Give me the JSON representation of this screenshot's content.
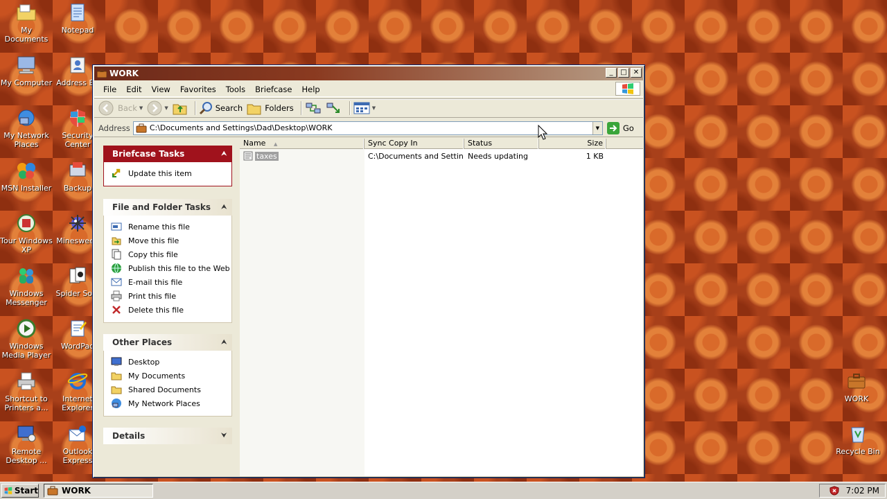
{
  "colors": {
    "briefcase_header": "#a0121c",
    "titlebar": "#6b2a1a",
    "desktop": "#a8401a"
  },
  "desktop_left": [
    {
      "label": "My Documents",
      "icon": "folder-documents-icon"
    },
    {
      "label": "My Computer",
      "icon": "computer-icon"
    },
    {
      "label": "My Network Places",
      "icon": "network-places-icon"
    },
    {
      "label": "MSN Installer",
      "icon": "msn-butterfly-icon"
    },
    {
      "label": "Tour Windows XP",
      "icon": "tour-icon"
    },
    {
      "label": "Windows Messenger",
      "icon": "messenger-icon"
    },
    {
      "label": "Windows Media Player",
      "icon": "media-player-icon"
    },
    {
      "label": "Shortcut to Printers a...",
      "icon": "printer-icon"
    },
    {
      "label": "Remote Desktop ...",
      "icon": "remote-desktop-icon"
    }
  ],
  "desktop_second": [
    {
      "label": "Notepad",
      "icon": "notepad-icon"
    },
    {
      "label": "Address Bo",
      "icon": "address-book-icon"
    },
    {
      "label": "Security Center",
      "icon": "security-shield-icon"
    },
    {
      "label": "Backup",
      "icon": "backup-icon"
    },
    {
      "label": "Minesweep",
      "icon": "minesweeper-icon"
    },
    {
      "label": "Spider Solit",
      "icon": "spider-solitaire-icon"
    },
    {
      "label": "WordPad",
      "icon": "wordpad-icon"
    },
    {
      "label": "Internet Explorer",
      "icon": "internet-explorer-icon"
    },
    {
      "label": "Outlook Express",
      "icon": "outlook-express-icon"
    }
  ],
  "desktop_right": [
    {
      "label": "WORK",
      "icon": "briefcase-icon"
    },
    {
      "label": "Recycle Bin",
      "icon": "recycle-bin-icon"
    }
  ],
  "window": {
    "title": "WORK",
    "menus": [
      "File",
      "Edit",
      "View",
      "Favorites",
      "Tools",
      "Briefcase",
      "Help"
    ],
    "toolbar": {
      "back": "Back",
      "search": "Search",
      "folders": "Folders"
    },
    "address_label": "Address",
    "address_value": "C:\\Documents and Settings\\Dad\\Desktop\\WORK",
    "go_label": "Go"
  },
  "taskpane": {
    "briefcase": {
      "title": "Briefcase Tasks",
      "items": [
        "Update this item"
      ]
    },
    "file_folder": {
      "title": "File and Folder Tasks",
      "items": [
        "Rename this file",
        "Move this file",
        "Copy this file",
        "Publish this file to the Web",
        "E-mail this file",
        "Print this file",
        "Delete this file"
      ]
    },
    "other_places": {
      "title": "Other Places",
      "items": [
        "Desktop",
        "My Documents",
        "Shared Documents",
        "My Network Places"
      ]
    },
    "details": {
      "title": "Details"
    }
  },
  "list": {
    "columns": [
      "Name",
      "Sync Copy In",
      "Status",
      "Size"
    ],
    "rows": [
      {
        "name": "taxes",
        "sync": "C:\\Documents and Settin...",
        "status": "Needs updating",
        "size": "1 KB"
      }
    ]
  },
  "taskbar": {
    "start": "Start",
    "task": "WORK",
    "clock": "7:02 PM"
  }
}
